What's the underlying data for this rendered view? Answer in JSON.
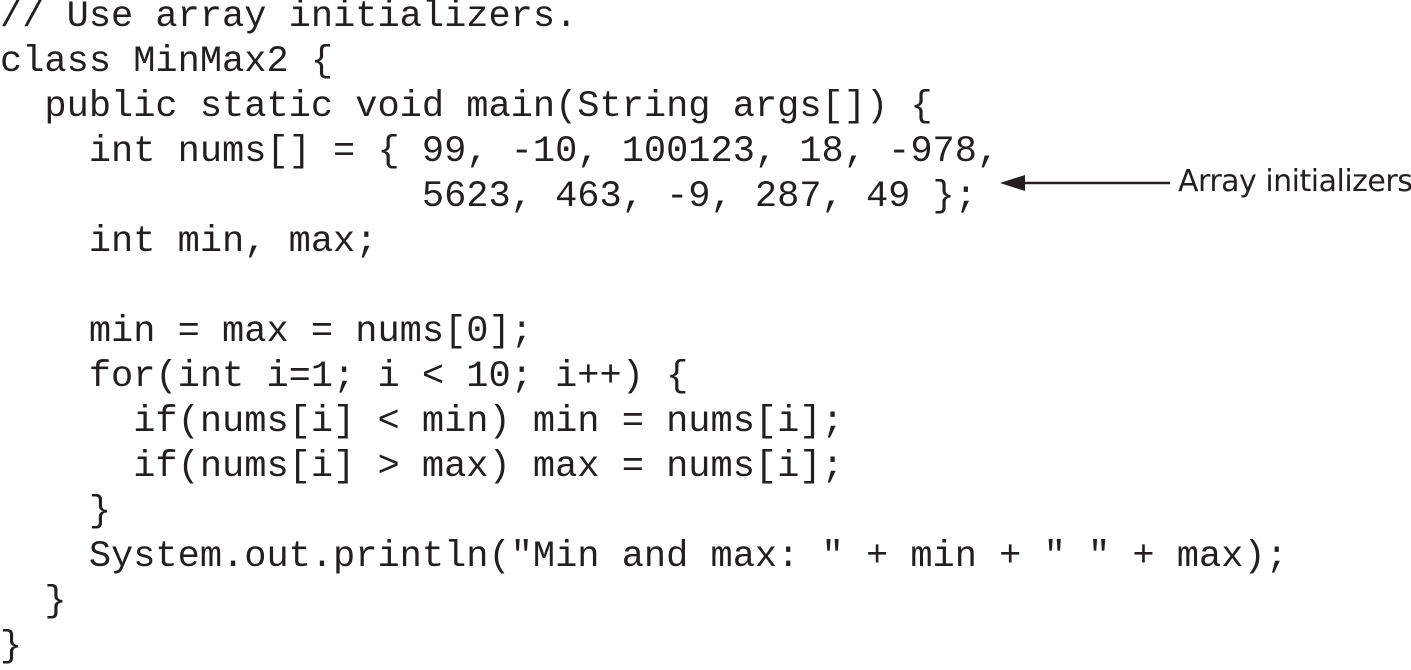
{
  "code_lines": [
    "// Use array initializers.",
    "class MinMax2 {",
    "  public static void main(String args[]) {",
    "    int nums[] = { 99, -10, 100123, 18, -978,",
    "                   5623, 463, -9, 287, 49 };",
    "    int min, max;",
    "",
    "    min = max = nums[0];",
    "    for(int i=1; i < 10; i++) {",
    "      if(nums[i] < min) min = nums[i];",
    "      if(nums[i] > max) max = nums[i];",
    "    }",
    "    System.out.println(\"Min and max: \" + min + \" \" + max);",
    "  }",
    "}"
  ],
  "callout": {
    "label": "Array initializers",
    "color": "#231f20"
  }
}
